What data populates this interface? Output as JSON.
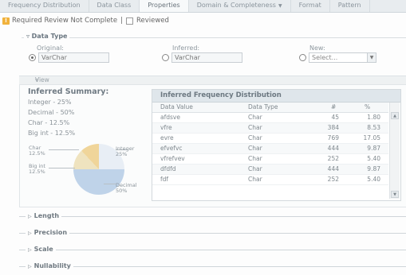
{
  "tabs": [
    {
      "label": "Frequency Distribution",
      "active": false
    },
    {
      "label": "Data Class",
      "active": false
    },
    {
      "label": "Properties",
      "active": true
    },
    {
      "label": "Domain & Completeness",
      "active": false,
      "dropdown": true
    },
    {
      "label": "Format",
      "active": false
    },
    {
      "label": "Pattern",
      "active": false
    }
  ],
  "review": {
    "required_label": "Required Review Not Complete",
    "reviewed_label": "Reviewed",
    "reviewed_checked": false
  },
  "data_type": {
    "legend": "Data Type",
    "original": {
      "label": "Original:",
      "value": "VarChar",
      "selected": true
    },
    "inferred": {
      "label": "Inferred:",
      "value": "VarChar",
      "selected": false
    },
    "new": {
      "label": "New:",
      "value": "Select...",
      "selected": false
    }
  },
  "view_summary": {
    "label": "View Summary"
  },
  "inferred_summary": {
    "title": "Inferred Summary:",
    "lines": [
      "Integer - 25%",
      "Decimal - 50%",
      "Char - 12.5%",
      "Big int - 12.5%"
    ]
  },
  "chart_data": {
    "type": "pie",
    "slices": [
      {
        "label": "Integer",
        "value": 25.0
      },
      {
        "label": "Decimal",
        "value": 50.0
      },
      {
        "label": "Char",
        "value": 12.5
      },
      {
        "label": "Big int",
        "value": 12.5
      }
    ],
    "labels": [
      {
        "name": "Integer",
        "pct": "25%"
      },
      {
        "name": "Decimal",
        "pct": "50%"
      },
      {
        "name": "Char",
        "pct": "12.5%"
      },
      {
        "name": "Big int",
        "pct": "12.5%"
      }
    ],
    "colors": [
      "#e8eef5",
      "#bfd3e9",
      "#efe3bf",
      "#f0d59a"
    ]
  },
  "frequency_table": {
    "title": "Inferred Frequency Distribution",
    "columns": [
      "Data Value",
      "Data Type",
      "#",
      "%"
    ],
    "rows": [
      [
        "afdsve",
        "Char",
        "45",
        "1.80"
      ],
      [
        "vfre",
        "Char",
        "384",
        "8.53"
      ],
      [
        "evre",
        "Char",
        "769",
        "17.05"
      ],
      [
        "efvefvc",
        "Char",
        "444",
        "9.87"
      ],
      [
        "vfrefvev",
        "Char",
        "252",
        "5.40"
      ],
      [
        "dfdfd",
        "Char",
        "444",
        "9.87"
      ],
      [
        "fdf",
        "Char",
        "252",
        "5.40"
      ]
    ]
  },
  "sections": [
    {
      "label": "Length"
    },
    {
      "label": "Precision"
    },
    {
      "label": "Scale"
    },
    {
      "label": "Nullability"
    }
  ]
}
